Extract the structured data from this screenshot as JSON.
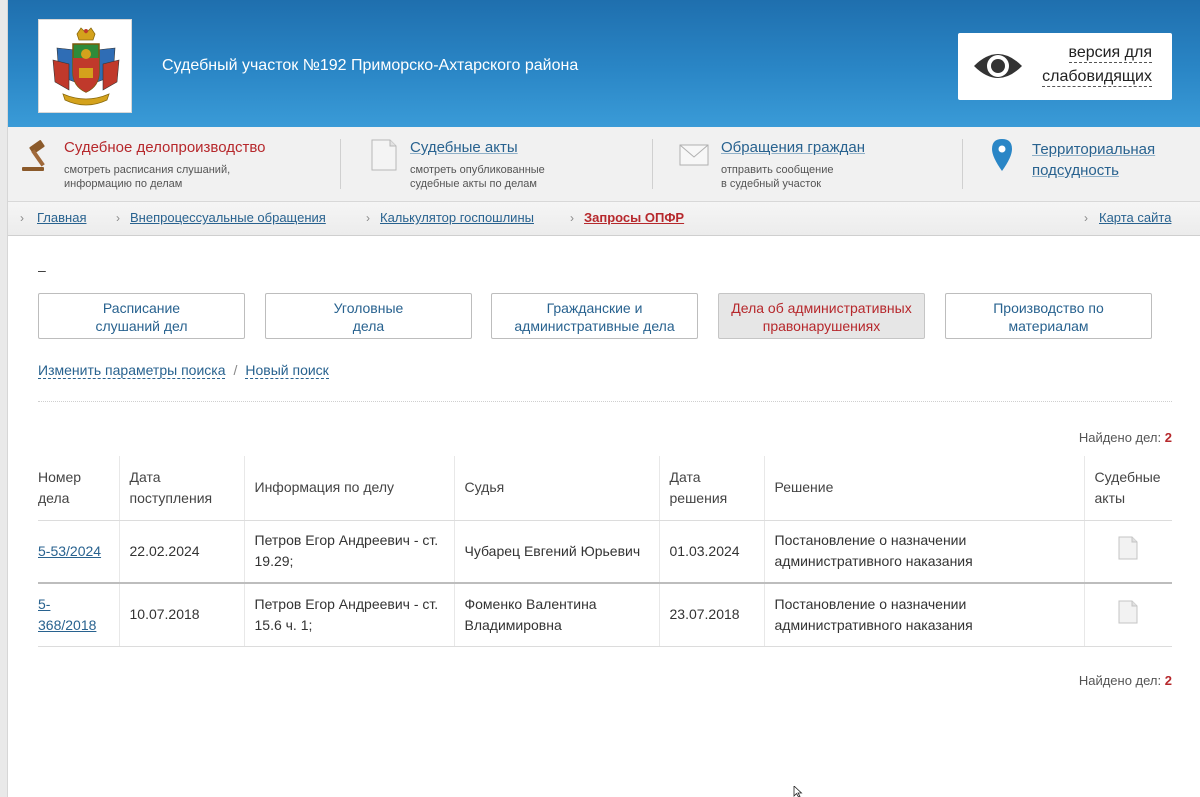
{
  "header": {
    "site_title": "Судебный участок №192 Приморско-Ахтарского района",
    "vision_line1": "версия для",
    "vision_line2": "слабовидящих"
  },
  "services": [
    {
      "title": "Судебное делопроизводство",
      "desc1": "смотреть расписания слушаний,",
      "desc2": "информацию по делам",
      "icon": "gavel-icon"
    },
    {
      "title": "Судебные акты",
      "desc1": "смотреть опубликованные",
      "desc2": "судебные акты по делам",
      "icon": "document-icon"
    },
    {
      "title": "Обращения граждан",
      "desc1": "отправить сообщение",
      "desc2": "в судебный участок",
      "icon": "envelope-icon"
    },
    {
      "title_line1": "Территориальная",
      "title_line2": "подсудность",
      "icon": "map-pin-icon"
    }
  ],
  "breadcrumbs": {
    "items": [
      "Главная",
      "Внепроцессуальные обращения",
      "Калькулятор госпошлины",
      "Запросы ОПФР"
    ],
    "sitemap": "Карта сайта"
  },
  "dash": "–",
  "categories": [
    {
      "line1": "Расписание",
      "line2": "слушаний дел"
    },
    {
      "line1": "Уголовные",
      "line2": "дела"
    },
    {
      "line1": "Гражданские и",
      "line2": "административные дела"
    },
    {
      "line1": "Дела об административных",
      "line2": "правонарушениях"
    },
    {
      "line1": "Производство по",
      "line2": "материалам"
    }
  ],
  "search_links": {
    "change": "Изменить параметры поиска",
    "separator": "/",
    "new": "Новый поиск"
  },
  "found": {
    "label": "Найдено дел:",
    "count": "2"
  },
  "table": {
    "headers": [
      {
        "l1": "Номер",
        "l2": "дела"
      },
      {
        "l1": "Дата",
        "l2": "поступления"
      },
      {
        "l1": "Информация по делу",
        "l2": ""
      },
      {
        "l1": "Судья",
        "l2": ""
      },
      {
        "l1": "Дата",
        "l2": "решения"
      },
      {
        "l1": "Решение",
        "l2": ""
      },
      {
        "l1": "Судебные",
        "l2": "акты"
      }
    ],
    "rows": [
      {
        "number": "5-53/2024",
        "received": "22.02.2024",
        "info_l1": "Петров Егор Андреевич - ст.",
        "info_l2": "19.29;",
        "judge_l1": "Чубарец Евгений Юрьевич",
        "judge_l2": "",
        "decision_date": "01.03.2024",
        "decision_l1": "Постановление о назначении",
        "decision_l2": "административного наказания"
      },
      {
        "number": "5-368/2018",
        "received": "10.07.2018",
        "info_l1": "Петров Егор Андреевич - ст.",
        "info_l2": "15.6 ч. 1;",
        "judge_l1": "Фоменко Валентина",
        "judge_l2": "Владимировна",
        "decision_date": "23.07.2018",
        "decision_l1": "Постановление о назначении",
        "decision_l2": "административного наказания"
      }
    ]
  },
  "colors": {
    "link": "#28628f",
    "accent_red": "#b6282c",
    "header_blue": "#2a86c6"
  }
}
